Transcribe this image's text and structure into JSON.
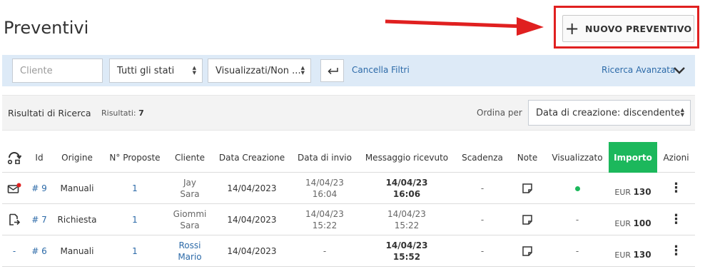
{
  "page": {
    "title": "Preventivi"
  },
  "actions": {
    "new_quote_label": "NUOVO PREVENTIVO"
  },
  "filters": {
    "client_placeholder": "Cliente",
    "status_value": "Tutti gli stati",
    "viewed_value": "Visualizzati/Non ...",
    "cancel_label": "Cancella Filtri",
    "advanced_label": "Ricerca Avanzata"
  },
  "results": {
    "label": "Risultati di Ricerca",
    "count_label": "Risultati:",
    "count": "7",
    "order_label": "Ordina per",
    "order_value": "Data di creazione: discendente"
  },
  "table": {
    "headers": [
      "Id",
      "Origine",
      "N° Proposte",
      "Cliente",
      "Data Creazione",
      "Data di invio",
      "Messaggio ricevuto",
      "Scadenza",
      "Note",
      "Visualizzato",
      "Importo",
      "Azioni"
    ],
    "rows": [
      {
        "status_icon": "envelope-alert-icon",
        "id": "# 9",
        "origin": "Manuali",
        "proposals": "1",
        "client_1": "Jay",
        "client_2": "Sara",
        "created": "14/04/2023",
        "sent_1": "14/04/23",
        "sent_2": "16:04",
        "received_1": "14/04/23",
        "received_2": "16:06",
        "deadline": "-",
        "viewed": "dot",
        "currency": "EUR",
        "amount": "130"
      },
      {
        "status_icon": "document-send-icon",
        "id": "# 7",
        "origin": "Richiesta",
        "proposals": "1",
        "client_1": "Giommi",
        "client_2": "Sara",
        "created": "14/04/2023",
        "sent_1": "14/04/23",
        "sent_2": "15:22",
        "received_1": "14/04/23",
        "received_2": "15:22",
        "deadline": "-",
        "viewed": "-",
        "currency": "EUR",
        "amount": "100"
      },
      {
        "status_icon": "-",
        "id": "# 6",
        "origin": "Manuali",
        "proposals": "1",
        "client_1": "Rossi",
        "client_2": "Mario",
        "created": "14/04/2023",
        "sent_1": "-",
        "sent_2": "",
        "received_1": "14/04/23",
        "received_2": "15:52",
        "deadline": "-",
        "viewed": "-",
        "currency": "EUR",
        "amount": "130"
      }
    ]
  },
  "colors": {
    "accent_green": "#1cb85c",
    "link_blue": "#2c6aa8",
    "filter_bg": "#ddeaf7",
    "highlight_red": "#e02020"
  }
}
